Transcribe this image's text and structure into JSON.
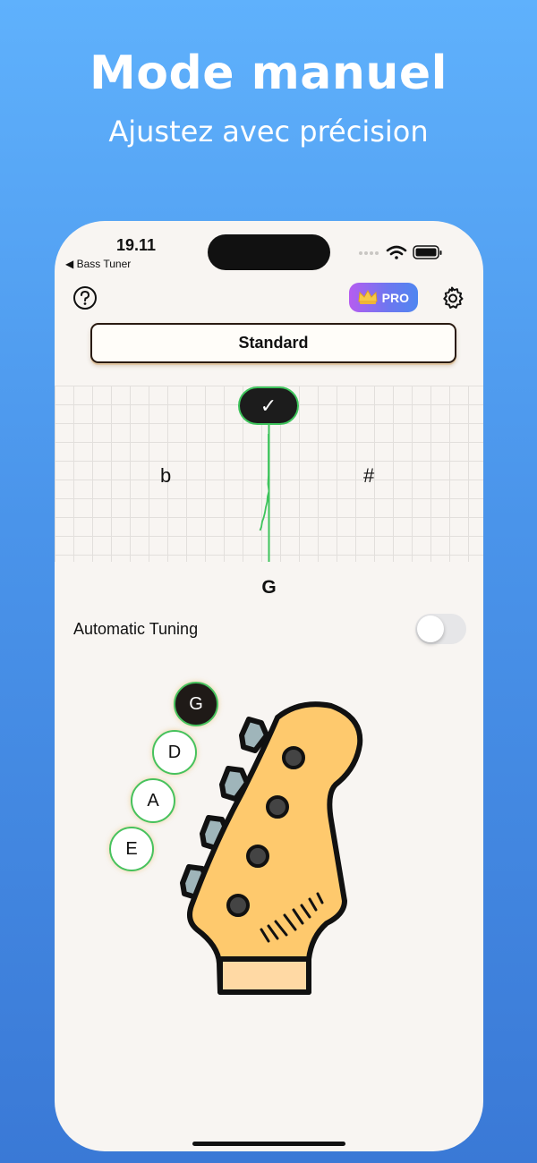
{
  "hero": {
    "title": "Mode manuel",
    "subtitle": "Ajustez avec précision"
  },
  "status_bar": {
    "time": "19.11",
    "back_app": "◀ Bass Tuner"
  },
  "toolbar": {
    "help_icon": "question-circle-icon",
    "pro_label": "PRO",
    "settings_icon": "gear-icon"
  },
  "tuning_preset": "Standard",
  "meter": {
    "flat_symbol": "b",
    "sharp_symbol": "#",
    "in_tune_symbol": "✓",
    "current_note": "G",
    "accent_color": "#3ec45c"
  },
  "auto_tuning": {
    "label": "Automatic Tuning",
    "enabled": false
  },
  "strings": [
    {
      "note": "G",
      "active": true
    },
    {
      "note": "D",
      "active": false
    },
    {
      "note": "A",
      "active": false
    },
    {
      "note": "E",
      "active": false
    }
  ]
}
